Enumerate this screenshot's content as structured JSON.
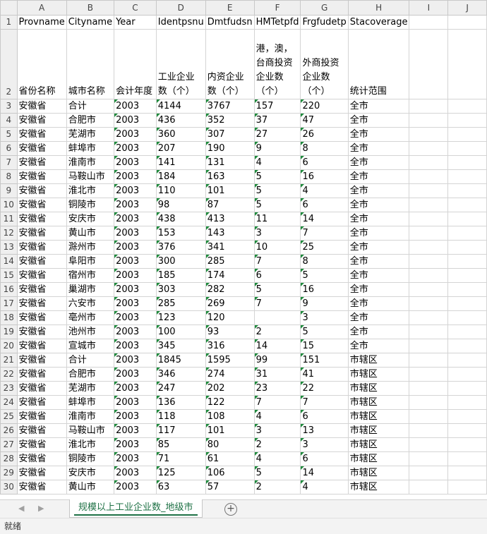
{
  "columns": [
    "",
    "A",
    "B",
    "C",
    "D",
    "E",
    "F",
    "G",
    "H",
    "I",
    "J"
  ],
  "row1": [
    "Provname",
    "Cityname",
    "Year",
    "Identpsnu",
    "Dmtfudsn",
    "HMTetpfd",
    "Frgfudetp",
    "Stacoverage",
    "",
    ""
  ],
  "row2": [
    "省份名称",
    "城市名称",
    "会计年度",
    "工业企业数（个）",
    "内资企业数（个）",
    "港，澳，台商投资企业数（个）",
    "外商投资企业数（个）",
    "统计范围",
    "",
    ""
  ],
  "rows": [
    [
      "3",
      "安徽省",
      "合计",
      "2003",
      "4144",
      "3767",
      "157",
      "220",
      "全市"
    ],
    [
      "4",
      "安徽省",
      "合肥市",
      "2003",
      "436",
      "352",
      "37",
      "47",
      "全市"
    ],
    [
      "5",
      "安徽省",
      "芜湖市",
      "2003",
      "360",
      "307",
      "27",
      "26",
      "全市"
    ],
    [
      "6",
      "安徽省",
      "蚌埠市",
      "2003",
      "207",
      "190",
      "9",
      "8",
      "全市"
    ],
    [
      "7",
      "安徽省",
      "淮南市",
      "2003",
      "141",
      "131",
      "4",
      "6",
      "全市"
    ],
    [
      "8",
      "安徽省",
      "马鞍山市",
      "2003",
      "184",
      "163",
      "5",
      "16",
      "全市"
    ],
    [
      "9",
      "安徽省",
      "淮北市",
      "2003",
      "110",
      "101",
      "5",
      "4",
      "全市"
    ],
    [
      "10",
      "安徽省",
      "铜陵市",
      "2003",
      "98",
      "87",
      "5",
      "6",
      "全市"
    ],
    [
      "11",
      "安徽省",
      "安庆市",
      "2003",
      "438",
      "413",
      "11",
      "14",
      "全市"
    ],
    [
      "12",
      "安徽省",
      "黄山市",
      "2003",
      "153",
      "143",
      "3",
      "7",
      "全市"
    ],
    [
      "13",
      "安徽省",
      "滁州市",
      "2003",
      "376",
      "341",
      "10",
      "25",
      "全市"
    ],
    [
      "14",
      "安徽省",
      "阜阳市",
      "2003",
      "300",
      "285",
      "7",
      "8",
      "全市"
    ],
    [
      "15",
      "安徽省",
      "宿州市",
      "2003",
      "185",
      "174",
      "6",
      "5",
      "全市"
    ],
    [
      "16",
      "安徽省",
      "巢湖市",
      "2003",
      "303",
      "282",
      "5",
      "16",
      "全市"
    ],
    [
      "17",
      "安徽省",
      "六安市",
      "2003",
      "285",
      "269",
      "7",
      "9",
      "全市"
    ],
    [
      "18",
      "安徽省",
      "亳州市",
      "2003",
      "123",
      "120",
      "",
      "3",
      "全市"
    ],
    [
      "19",
      "安徽省",
      "池州市",
      "2003",
      "100",
      "93",
      "2",
      "5",
      "全市"
    ],
    [
      "20",
      "安徽省",
      "宣城市",
      "2003",
      "345",
      "316",
      "14",
      "15",
      "全市"
    ],
    [
      "21",
      "安徽省",
      "合计",
      "2003",
      "1845",
      "1595",
      "99",
      "151",
      "市辖区"
    ],
    [
      "22",
      "安徽省",
      "合肥市",
      "2003",
      "346",
      "274",
      "31",
      "41",
      "市辖区"
    ],
    [
      "23",
      "安徽省",
      "芜湖市",
      "2003",
      "247",
      "202",
      "23",
      "22",
      "市辖区"
    ],
    [
      "24",
      "安徽省",
      "蚌埠市",
      "2003",
      "136",
      "122",
      "7",
      "7",
      "市辖区"
    ],
    [
      "25",
      "安徽省",
      "淮南市",
      "2003",
      "118",
      "108",
      "4",
      "6",
      "市辖区"
    ],
    [
      "26",
      "安徽省",
      "马鞍山市",
      "2003",
      "117",
      "101",
      "3",
      "13",
      "市辖区"
    ],
    [
      "27",
      "安徽省",
      "淮北市",
      "2003",
      "85",
      "80",
      "2",
      "3",
      "市辖区"
    ],
    [
      "28",
      "安徽省",
      "铜陵市",
      "2003",
      "71",
      "61",
      "4",
      "6",
      "市辖区"
    ],
    [
      "29",
      "安徽省",
      "安庆市",
      "2003",
      "125",
      "106",
      "5",
      "14",
      "市辖区"
    ],
    [
      "30",
      "安徽省",
      "黄山市",
      "2003",
      "63",
      "57",
      "2",
      "4",
      "市辖区"
    ]
  ],
  "sheet_tab": "规模以上工业企业数_地级市",
  "status": "就绪",
  "icons": {
    "prev_sheet": "triangle-left",
    "next_sheet": "triangle-right",
    "add_sheet": "plus-circle"
  },
  "colors": {
    "accent": "#1e7145",
    "marker": "#1e8a3c",
    "header_bg": "#efefef"
  }
}
